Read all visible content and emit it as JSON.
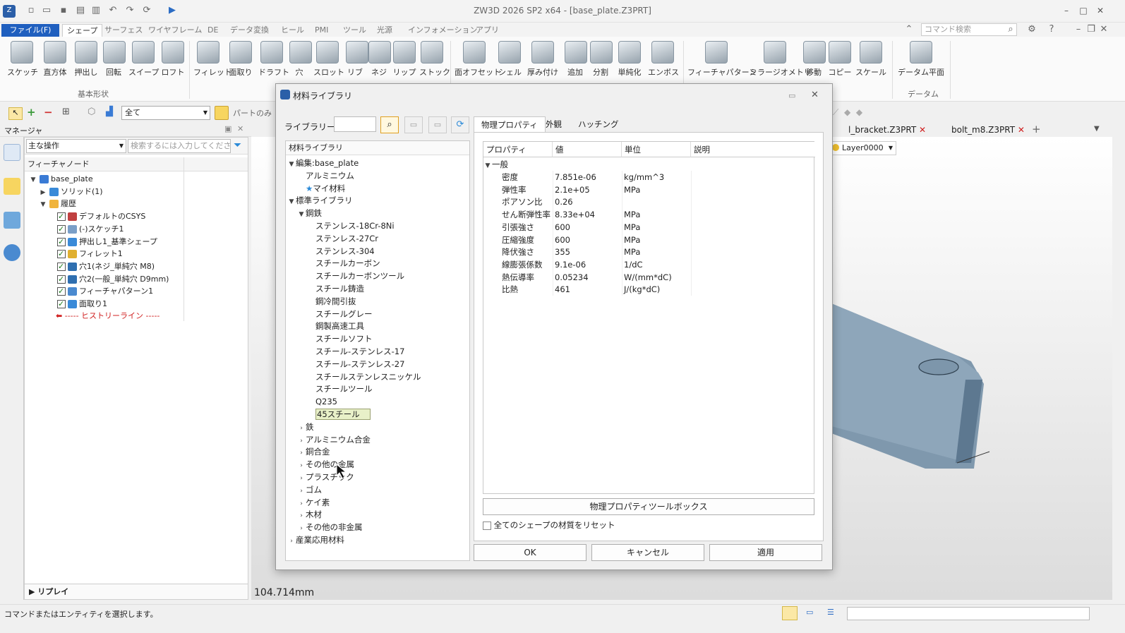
{
  "app": {
    "title": "ZW3D 2026 SP2 x64  - [base_plate.Z3PRT]",
    "command_search_placeholder": "コマンド検索"
  },
  "menu_tabs": [
    "ファイル(F)",
    "シェープ",
    "サーフェス",
    "ワイヤフレーム",
    "DE",
    "データ変換",
    "ヒール",
    "PMI",
    "ツール",
    "光源",
    "インフォメーション",
    "アプリ"
  ],
  "ribbon": {
    "buttons": [
      "スケッチ",
      "直方体",
      "押出し",
      "回転",
      "スイープ",
      "ロフト",
      "フィレット",
      "面取り",
      "ドラフト",
      "穴",
      "スロット",
      "リブ",
      "ネジ",
      "リップ",
      "ストック",
      "面オフセット",
      "シェル",
      "厚み付け",
      "追加",
      "分割",
      "単純化",
      "エンボス",
      "フィーチャパターン",
      "ミラージオメトリ",
      "移動",
      "コピー",
      "スケール",
      "データム平面"
    ],
    "groups": {
      "basic": "基本形状",
      "datum": "データム"
    }
  },
  "toolbar": {
    "filter_value": "全て",
    "part_only": "パートのみ"
  },
  "manager": {
    "title": "マネージャ",
    "mode": "主な操作",
    "search_placeholder": "検索するには入力してください",
    "column": "フィーチャノード",
    "nodes": [
      {
        "label": "base_plate",
        "indent": 0,
        "expand": "▼",
        "check": false,
        "icon": "part-icon",
        "color": "#3a7bd5"
      },
      {
        "label": "ソリッド(1)",
        "indent": 1,
        "expand": "▶",
        "check": false,
        "icon": "solid-icon",
        "color": "#3a8ad8"
      },
      {
        "label": "履歴",
        "indent": 1,
        "expand": "▼",
        "check": false,
        "icon": "folder-icon",
        "color": "#f0b43c"
      },
      {
        "label": "デフォルトのCSYS",
        "indent": 2,
        "expand": "",
        "check": true,
        "icon": "csys-icon",
        "color": "#c04040"
      },
      {
        "label": "(-)スケッチ1",
        "indent": 2,
        "expand": "",
        "check": true,
        "icon": "sketch-icon",
        "color": "#7a9fc8"
      },
      {
        "label": "押出し1_基準シェープ",
        "indent": 2,
        "expand": "",
        "check": true,
        "icon": "extrude-icon",
        "color": "#3a8ad8"
      },
      {
        "label": "フィレット1",
        "indent": 2,
        "expand": "",
        "check": true,
        "icon": "fillet-icon",
        "color": "#e0b030"
      },
      {
        "label": "穴1(ネジ_単純穴 M8)",
        "indent": 2,
        "expand": "",
        "check": true,
        "icon": "hole-icon",
        "color": "#2f6fb0"
      },
      {
        "label": "穴2(一般_単純穴 D9mm)",
        "indent": 2,
        "expand": "",
        "check": true,
        "icon": "hole-icon",
        "color": "#2f6fb0"
      },
      {
        "label": "フィーチャパターン1",
        "indent": 2,
        "expand": "",
        "check": true,
        "icon": "pattern-icon",
        "color": "#4a8ad0"
      },
      {
        "label": "面取り1",
        "indent": 2,
        "expand": "",
        "check": true,
        "icon": "chamfer-icon",
        "color": "#3a8ad8"
      }
    ],
    "history_line": "----- ヒストリーライン -----",
    "replay": "リプレイ"
  },
  "doc_tabs": [
    "l_bracket.Z3PRT",
    "bolt_m8.Z3PRT"
  ],
  "layer": "Layer0000",
  "measurement": "104.714mm",
  "status_text": "コマンドまたはエンティティを選択します。",
  "dialog": {
    "title": "材料ライブラリ",
    "library_label": "ライブラリー覧",
    "tree_header": "材料ライブラリ",
    "tree": [
      {
        "label": "編集:base_plate",
        "level": 0,
        "expand": "▼"
      },
      {
        "label": "アルミニウム",
        "level": 1,
        "expand": ""
      },
      {
        "label": "マイ材料",
        "level": 1,
        "expand": "",
        "star": true
      },
      {
        "label": "標準ライブラリ",
        "level": 0,
        "expand": "▼"
      },
      {
        "label": "鋼鉄",
        "level": 1,
        "expand": "▼"
      },
      {
        "label": "ステンレス-18Cr-8Ni",
        "level": 2,
        "expand": ""
      },
      {
        "label": "ステンレス-27Cr",
        "level": 2,
        "expand": ""
      },
      {
        "label": "ステンレス-304",
        "level": 2,
        "expand": ""
      },
      {
        "label": "スチールカーボン",
        "level": 2,
        "expand": ""
      },
      {
        "label": "スチールカーボンツール",
        "level": 2,
        "expand": ""
      },
      {
        "label": "スチール鋳造",
        "level": 2,
        "expand": ""
      },
      {
        "label": "鋼冷間引抜",
        "level": 2,
        "expand": ""
      },
      {
        "label": "スチールグレー",
        "level": 2,
        "expand": ""
      },
      {
        "label": "鋼製高速工具",
        "level": 2,
        "expand": ""
      },
      {
        "label": "スチールソフト",
        "level": 2,
        "expand": ""
      },
      {
        "label": "スチール-ステンレス-17",
        "level": 2,
        "expand": ""
      },
      {
        "label": "スチール-ステンレス-27",
        "level": 2,
        "expand": ""
      },
      {
        "label": "スチールステンレスニッケル",
        "level": 2,
        "expand": ""
      },
      {
        "label": "スチールツール",
        "level": 2,
        "expand": ""
      },
      {
        "label": "Q235",
        "level": 2,
        "expand": ""
      },
      {
        "label": "45スチール",
        "level": 2,
        "expand": "",
        "selected": true
      },
      {
        "label": "鉄",
        "level": 1,
        "expand": "›"
      },
      {
        "label": "アルミニウム合金",
        "level": 1,
        "expand": "›"
      },
      {
        "label": "銅合金",
        "level": 1,
        "expand": "›"
      },
      {
        "label": "その他の金属",
        "level": 1,
        "expand": "›"
      },
      {
        "label": "プラスチック",
        "level": 1,
        "expand": "›"
      },
      {
        "label": "ゴム",
        "level": 1,
        "expand": "›"
      },
      {
        "label": "ケイ素",
        "level": 1,
        "expand": "›"
      },
      {
        "label": "木材",
        "level": 1,
        "expand": "›"
      },
      {
        "label": "その他の非金属",
        "level": 1,
        "expand": "›"
      },
      {
        "label": "産業応用材料",
        "level": 0,
        "expand": "›"
      }
    ],
    "tabs": [
      "物理プロパティ",
      "外観",
      "ハッチング"
    ],
    "table_headers": [
      "プロパティ",
      "値",
      "単位",
      "説明"
    ],
    "group": "一般",
    "properties": [
      {
        "name": "密度",
        "value": "7.851e-06",
        "unit": "kg/mm^3"
      },
      {
        "name": "弾性率",
        "value": "2.1e+05",
        "unit": "MPa"
      },
      {
        "name": "ポアソン比",
        "value": "0.26",
        "unit": ""
      },
      {
        "name": "せん断弾性率",
        "value": "8.33e+04",
        "unit": "MPa"
      },
      {
        "name": "引張強さ",
        "value": "600",
        "unit": "MPa"
      },
      {
        "name": "圧縮強度",
        "value": "600",
        "unit": "MPa"
      },
      {
        "name": "降伏強さ",
        "value": "355",
        "unit": "MPa"
      },
      {
        "name": "線膨張係数",
        "value": "9.1e-06",
        "unit": "1/dC"
      },
      {
        "name": "熱伝導率",
        "value": "0.05234",
        "unit": "W/(mm*dC)"
      },
      {
        "name": "比熱",
        "value": "461",
        "unit": "J/(kg*dC)"
      }
    ],
    "toolbox_button": "物理プロパティツールボックス",
    "reset_label": "全てのシェープの材質をリセット",
    "ok": "OK",
    "cancel": "キャンセル",
    "apply": "適用"
  }
}
